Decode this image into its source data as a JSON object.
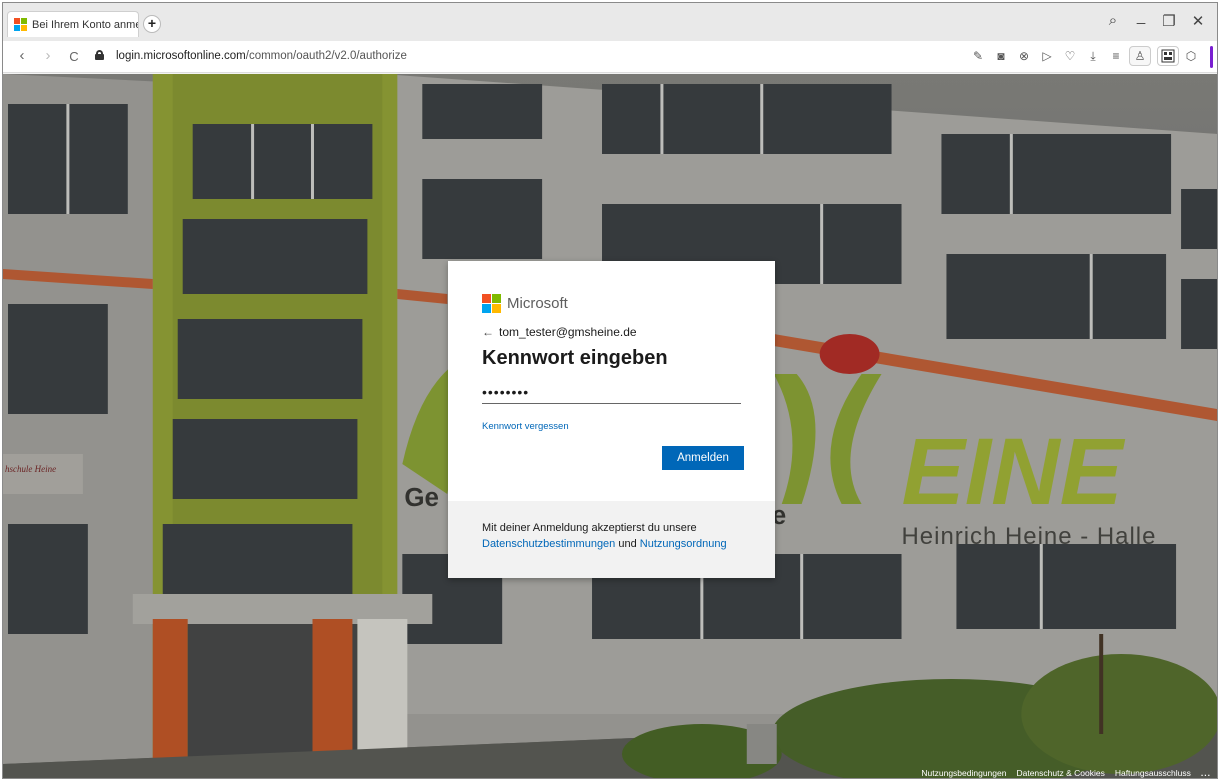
{
  "browser": {
    "tab": {
      "title": "Bei Ihrem Konto anmelde",
      "new_tab_label": "+"
    },
    "window_controls": {
      "search": "⌕",
      "minimize": "_",
      "restore": "❐",
      "close": "✕"
    },
    "nav": {
      "back": "‹",
      "forward": "›",
      "reload": "C"
    },
    "address": {
      "host": "login.microsoftonline.com",
      "path": "/common/oauth2/v2.0/authorize"
    },
    "toolbar_icons": [
      "edit-icon",
      "camera-icon",
      "block-icon",
      "send-icon",
      "heart-icon",
      "download-icon",
      "menu-icon",
      "profile-icon",
      "extension-icon",
      "cube-icon"
    ],
    "accent": "#7a1fd1"
  },
  "login_card": {
    "brand": "Microsoft",
    "identity": "tom_tester@gmsheine.de",
    "heading": "Kennwort eingeben",
    "password_value": "••••••••",
    "forgot_link": "Kennwort vergessen",
    "signin_button": "Anmelden",
    "terms_text": "Mit deiner Anmeldung akzeptierst du unsere",
    "privacy_link": "Datenschutzbestimmungen",
    "conjunction": "und",
    "usage_link": "Nutzungsordnung",
    "colors": {
      "primary": "#0067b8",
      "ms_red": "#f25022",
      "ms_green": "#7fba00",
      "ms_blue": "#00a4ef",
      "ms_yellow": "#ffb900"
    }
  },
  "background": {
    "signage": "Heinrich Heine - Halle",
    "big_letters": "EINE",
    "partial_letters": "Ge",
    "partial_letter_e": "e",
    "plaque": "hschule Heine"
  },
  "footer": {
    "terms": "Nutzungsbedingungen",
    "privacy": "Datenschutz & Cookies",
    "disclaimer": "Haftungsausschluss",
    "more": "..."
  }
}
